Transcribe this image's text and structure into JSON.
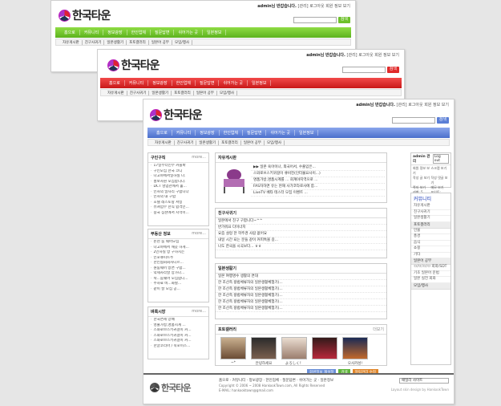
{
  "brand": {
    "logo_text": "한국타운"
  },
  "topbar": {
    "user": "admin님 반갑습니다.",
    "links": "[관리]  로그아웃  회원 정보 보기"
  },
  "search": {
    "button": "검색"
  },
  "nav": {
    "items": [
      "홈으로",
      "커뮤니티",
      "정보광장",
      "한인업체",
      "질문답변",
      "쉬어가는 곳",
      "일본정보"
    ]
  },
  "subnav": {
    "items": [
      "자유게시판",
      "친구사귀기",
      "일본생활기",
      "포토갤러리",
      "일본어 공부",
      "모임/행사"
    ]
  },
  "colors": {
    "green": "#6ec12b",
    "red": "#e02a2a",
    "blue": "#5b7fd6"
  },
  "left": {
    "jobs": {
      "title": "구인구직",
      "more": "more...",
      "items": [
        "17일부터인부 커플바",
        "구인모집 한국 코디",
        "나고야에서일하실 나.",
        "홍보사원 모집합니다.",
        "DCT 영업관에서 홀...",
        "인사의 일자리 구합니다",
        "인사의 내 구합",
        "호텔 레스토랑 서빙",
        "퓨쳐업무 한직 합격인...",
        "중국 심천에서 지역이..."
      ]
    },
    "realty": {
      "title": "부동산 정보",
      "more": "more...",
      "items": [
        "논현    룸 쉐어모집",
        "나고야에서 깨끗 하게...",
        "2인사실 방 구하시는",
        "인포큐피트주",
        "한인협회회사니르...",
        "원룸쉐어 방면 구합...",
        "약세사라살 양가나...",
        "숙...룸쉐어 모집합니...",
        "주차료 비...화할...",
        "같이 살 모집 공..."
      ]
    },
    "market": {
      "title": "벼룩시장",
      "more": "more...",
      "items": [
        "한국면세 양배",
        "영출가방,명품시계 ...",
        "스와로브스키귀걸이 커...",
        "스와로브스키귀걸이 커...",
        "스와로브스키귀걸이 커...",
        "한글코리아 / 북포이스..."
      ]
    }
  },
  "free_board": {
    "title": "자유게시판",
    "items": [
      "▶▶ 일본 육아이나, 외국어서, 수출입은...",
      "스와로브스키귀걸이 큐비진(인터불요사이...)",
      "명품가방,명품시계를 ... 회계야지역으로 ...",
      "FAS자하면 유는 현재 사가코타로사에 함...",
      "LiveTV 베타 테스터 모집 이벤트 ..."
    ]
  },
  "friends": {
    "title": "친구사귀기",
    "items": [
      "일본에서 친구 구합니다~^^",
      "반가워요 다이너지",
      "요즘 설렁 한 학주경 사람 없어요",
      "내일 시간 되는 분들 같이 커피톡볼 길...",
      "나도 한국을 시곡보다... ㅎㅎ"
    ]
  },
  "life": {
    "title": "일본생활기",
    "items": [
      "일본 여행명수 생활의 면대",
      "한 조선족 왕법체류자의 일본생활체험기(...",
      "한 조선족 왕법체류자의 일본생활체험기(...",
      "한 조선족 왕법체류자의 일본생활체험기(...",
      "한 조선족 왕법체류자의 일본생활체험기(...",
      "한 조선족 왕법체류자의 일본생활체험기(..."
    ]
  },
  "photo": {
    "title": "포토갤러리",
    "more": "더보기",
    "captions": [
      "~*",
      "안녕하세요",
      "よろしく！",
      "",
      "오사카성!"
    ]
  },
  "right": {
    "user": "admin 관리",
    "logout": "Log out",
    "stats": [
      "회원 정보 보기",
      "스크랩 보기",
      "작성 글 보기",
      "작성 댓글 보기",
      "쪽지 보기",
      "메모 보기",
      "레벨: 5",
      "포인트: 2010"
    ],
    "heading": "커뮤니티",
    "community": [
      "자유게시판",
      "친구사귀기",
      "일본생활기"
    ],
    "photo_head": "포토갤러리",
    "photo_items": [
      "인물",
      "풍경",
      "음식",
      "쇼핑",
      "기타"
    ],
    "study_head": "일본어 공부",
    "study_items": [
      "ㅁ/ㅁ/ㅁ/ㅁ 회화/SDT",
      "기초 일본어 문법",
      "일본 실전 회화"
    ],
    "event_head": "모임/행사"
  },
  "buttons": {
    "b1": "회원정보 재설정",
    "b2": "검색",
    "b3": "알림관리 수정"
  },
  "footer": {
    "links": "홈으로 · 커뮤니티 · 정보광장 · 한인업체 · 질문답변 · 쉬어가는 곳 · 일본정보",
    "copyright": "Copyright © 2006 ~ 2008 HankookTown.com, All Rights Reserved",
    "mail": "E-MAIL: hankooktown@gmail.com",
    "family": "패밀리 사이트",
    "design": "Layout skin design by HankookTown"
  }
}
